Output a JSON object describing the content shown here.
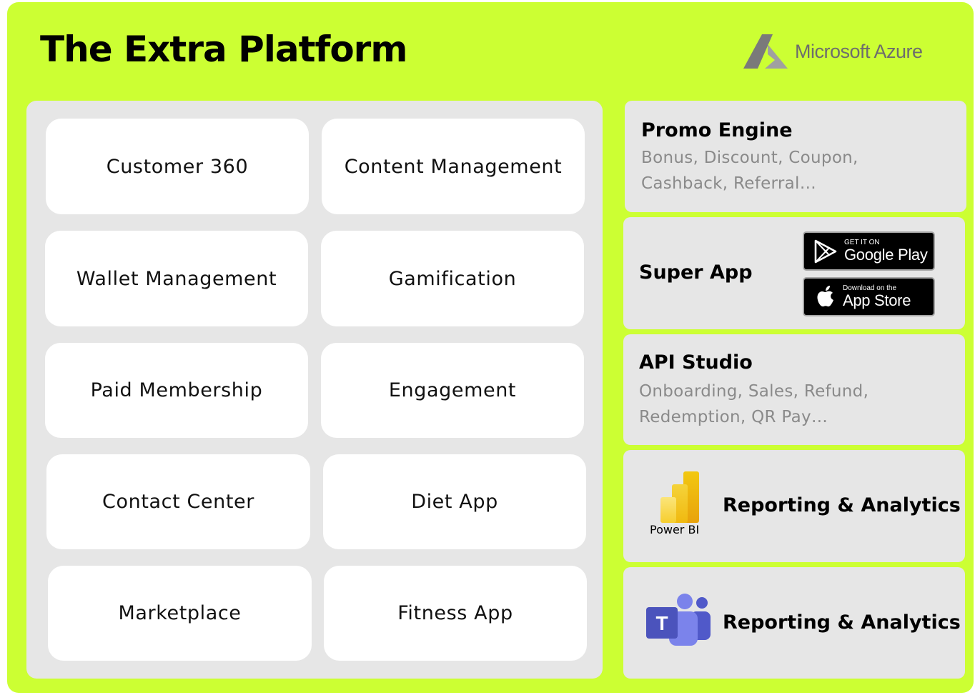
{
  "header": {
    "title": "The Extra Platform",
    "brand": "Microsoft Azure",
    "brand_icon": "azure-logo"
  },
  "modules": [
    {
      "label": "Customer 360"
    },
    {
      "label": "Content Management"
    },
    {
      "label": "Wallet Management"
    },
    {
      "label": "Gamification"
    },
    {
      "label": "Paid Membership"
    },
    {
      "label": "Engagement"
    },
    {
      "label": "Contact Center"
    },
    {
      "label": "Diet App"
    },
    {
      "label": "Marketplace"
    },
    {
      "label": "Fitness App"
    }
  ],
  "side": {
    "promo": {
      "title": "Promo Engine",
      "line1": "Bonus, Discount, Coupon,",
      "line2": "Cashback, Referral…"
    },
    "super_app": {
      "title": "Super App",
      "google_small": "GET IT ON",
      "google_big": "Google Play",
      "apple_small": "Download on the",
      "apple_big": "App Store"
    },
    "api": {
      "title": "API Studio",
      "line1": "Onboarding, Sales, Refund,",
      "line2": "Redemption, QR Pay…"
    },
    "reporting_pbi": {
      "title": "Reporting & Analytics",
      "logo_label": "Power BI"
    },
    "reporting_teams": {
      "title": "Reporting & Analytics"
    }
  },
  "colors": {
    "background": "#ccff33",
    "panel": "#e6e6e6",
    "tile": "#ffffff",
    "subtext": "#8a8a8a"
  }
}
